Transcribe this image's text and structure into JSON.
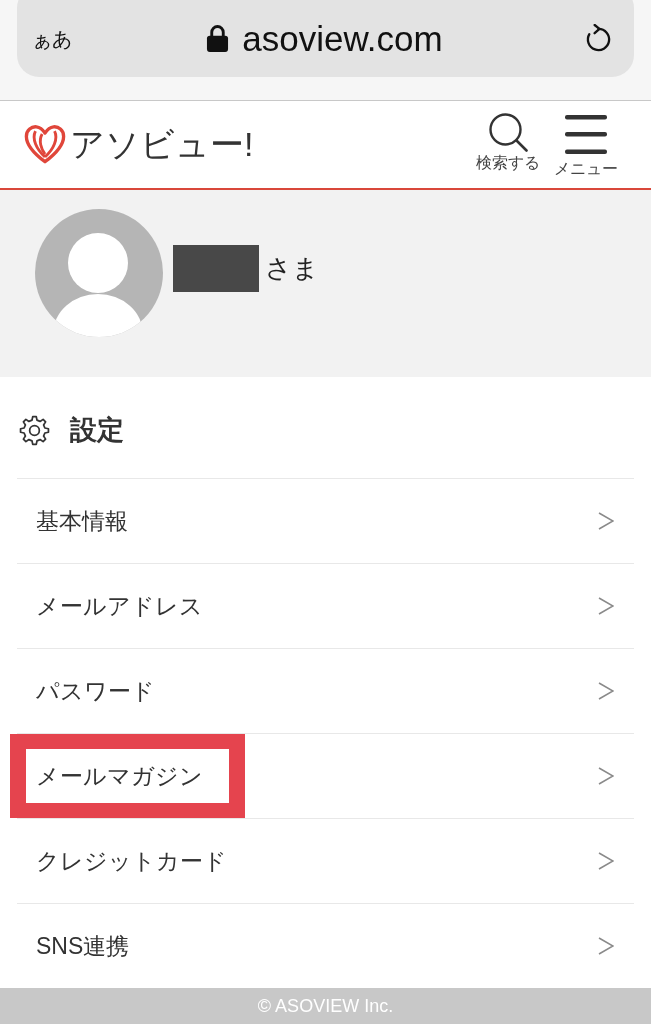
{
  "browser": {
    "text_size_button": "ぁあ",
    "url": "asoview.com"
  },
  "header": {
    "logo_text": "アソビュー!",
    "search_label": "検索する",
    "menu_label": "メニュー"
  },
  "profile": {
    "honorific": "さま"
  },
  "settings": {
    "title": "設定",
    "items": [
      {
        "label": "基本情報",
        "highlighted": false
      },
      {
        "label": "メールアドレス",
        "highlighted": false
      },
      {
        "label": "パスワード",
        "highlighted": false
      },
      {
        "label": "メールマガジン",
        "highlighted": true
      },
      {
        "label": "クレジットカード",
        "highlighted": false
      },
      {
        "label": "SNS連携",
        "highlighted": false
      }
    ]
  },
  "footer": {
    "copyright": "© ASOVIEW Inc."
  }
}
